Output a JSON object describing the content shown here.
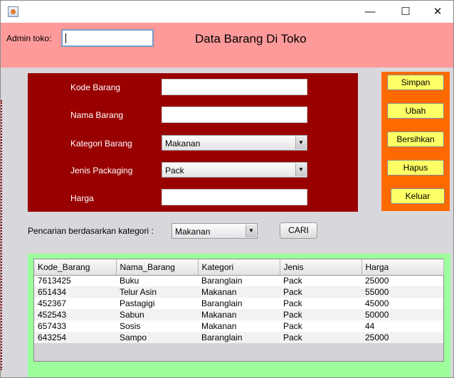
{
  "window": {
    "min_glyph": "—",
    "max_glyph": "☐",
    "close_glyph": "✕"
  },
  "header": {
    "admin_label": "Admin toko:",
    "admin_value": "",
    "title": "Data Barang Di Toko"
  },
  "form": {
    "kode_label": "Kode Barang",
    "kode_value": "",
    "nama_label": "Nama Barang",
    "nama_value": "",
    "kategori_label": "Kategori Barang",
    "kategori_value": "Makanan",
    "packaging_label": "Jenis Packaging",
    "packaging_value": "Pack",
    "harga_label": "Harga",
    "harga_value": ""
  },
  "buttons": {
    "simpan": "Simpan",
    "ubah": "Ubah",
    "bersihkan": "Bersihkan",
    "hapus": "Hapus",
    "keluar": "Keluar"
  },
  "search": {
    "label": "Pencarian berdasarkan kategori :",
    "value": "Makanan",
    "button": "CARI"
  },
  "table": {
    "columns": [
      "Kode_Barang",
      "Nama_Barang",
      "Kategori",
      "Jenis",
      "Harga"
    ],
    "rows": [
      [
        "7613425",
        "Buku",
        "Baranglain",
        "Pack",
        "25000"
      ],
      [
        "651434",
        "Telur Asin",
        "Makanan",
        "Pack",
        "55000"
      ],
      [
        "452367",
        "Pastagigi",
        "Baranglain",
        "Pack",
        "45000"
      ],
      [
        "452543",
        "Sabun",
        "Makanan",
        "Pack",
        "50000"
      ],
      [
        "657433",
        "Sosis",
        "Makanan",
        "Pack",
        "44"
      ],
      [
        "643254",
        "Sampo",
        "Baranglain",
        "Pack",
        "25000"
      ]
    ]
  },
  "colors": {
    "header_bg": "#ff9a9a",
    "form_bg": "#990000",
    "button_panel_bg": "#ff6a00",
    "button_bg": "#ffff66",
    "table_panel_bg": "#9cff9c"
  },
  "icons": {
    "app": "java-app-icon",
    "combo_arrow": "chevron-down-icon"
  }
}
